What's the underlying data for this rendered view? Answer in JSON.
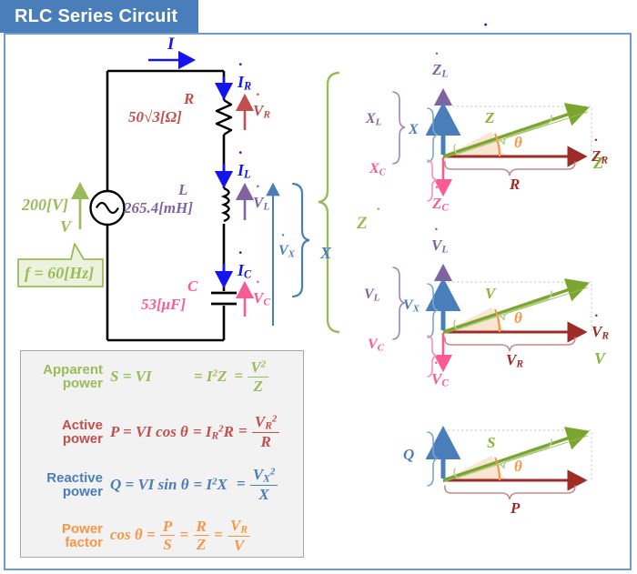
{
  "title": "RLC Series Circuit",
  "theme": {
    "title_bar": "#4a7ebb",
    "frame_border": "#6f9ad3",
    "resistor": "#c0504d",
    "resistor_dark": "#9e2b25",
    "inductor": "#8064a2",
    "capacitor": "#fb5b93",
    "current": "#1414ee",
    "reactance": "#4a7ebb",
    "source": "#9bbb59",
    "impedance": "#8cb238",
    "angle": "#f79646",
    "panel_bg": "#f2f2f2"
  },
  "circuit": {
    "current_label": "I",
    "current_R": "I",
    "current_R_sub": "R",
    "current_L": "I",
    "current_L_sub": "L",
    "current_C": "I",
    "current_C_sub": "C",
    "source_symbol": "V",
    "source_value": "200[V]",
    "frequency": "f = 60[Hz]",
    "resistor_name": "R",
    "resistor_value": "50√3[Ω]",
    "resistor_voltage": "V",
    "resistor_voltage_sub": "R",
    "inductor_name": "L",
    "inductor_value": "265.4[mH]",
    "inductor_voltage": "V",
    "inductor_voltage_sub": "L",
    "capacitor_name": "C",
    "capacitor_value": "53[μF]",
    "capacitor_voltage": "V",
    "capacitor_voltage_sub": "C",
    "vx_label": "V",
    "vx_sub": "X",
    "x_brace_label": "X",
    "z_brace_label": "Z"
  },
  "impedance_diagram": {
    "axis_up": "Z",
    "axis_up_sub": "L",
    "axis_down": "Z",
    "axis_down_sub": "C",
    "axis_right": "Z",
    "axis_right_sub": "R",
    "resultant": "Z",
    "magnitude": "Z",
    "real_brace": "R",
    "xl_brace": "X",
    "xl_brace_sub": "L",
    "xc_brace": "X",
    "xc_brace_sub": "C",
    "x_brace": "X",
    "angle": "θ"
  },
  "voltage_diagram": {
    "axis_up": "V",
    "axis_up_sub": "L",
    "axis_down": "V",
    "axis_down_sub": "C",
    "axis_right": "V",
    "axis_right_sub": "R",
    "resultant": "V",
    "magnitude": "V",
    "real_brace": "V",
    "real_brace_sub": "R",
    "vl_brace": "V",
    "vl_brace_sub": "L",
    "vc_brace": "V",
    "vc_brace_sub": "C",
    "vx_brace": "V",
    "vx_brace_sub": "X",
    "angle": "θ"
  },
  "power_diagram": {
    "reactive": "Q",
    "apparent": "S",
    "active": "P",
    "angle": "θ"
  },
  "formulas": {
    "rows": [
      {
        "tag_line1": "Apparent",
        "tag_line2": "power",
        "color": "#9bbb59",
        "lhs": "S = VI",
        "mid": "= I",
        "mid_sup": "2",
        "mid_tail": "Z",
        "frac_prefix": "=",
        "frac_num": "V",
        "frac_num_sup": "2",
        "frac_den": "Z"
      },
      {
        "tag_line1": "Active",
        "tag_line2": "power",
        "color": "#c0504d",
        "lhs": "P = VI cos θ",
        "mid": "= I",
        "mid_sub": "R",
        "mid_sup": "2",
        "mid_tail": "R",
        "frac_prefix": "=",
        "frac_num": "V",
        "frac_num_sub": "R",
        "frac_num_sup": "2",
        "frac_den": "R"
      },
      {
        "tag_line1": "Reactive",
        "tag_line2": "power",
        "color": "#4a7ebb",
        "lhs": "Q = VI sin θ",
        "mid": "= I",
        "mid_sup": "2",
        "mid_tail": "X",
        "frac_prefix": "=",
        "frac_num": "V",
        "frac_num_sub": "X",
        "frac_num_sup": "2",
        "frac_den": "X"
      },
      {
        "tag_line1": "Power",
        "tag_line2": "factor",
        "color": "#f79646",
        "lhs": "cos θ =",
        "f1_num": "P",
        "f1_den": "S",
        "eq1": "=",
        "f2_num": "R",
        "f2_den": "Z",
        "eq2": "=",
        "f3_num": "V",
        "f3_num_sub": "R",
        "f3_den": "V"
      }
    ]
  }
}
